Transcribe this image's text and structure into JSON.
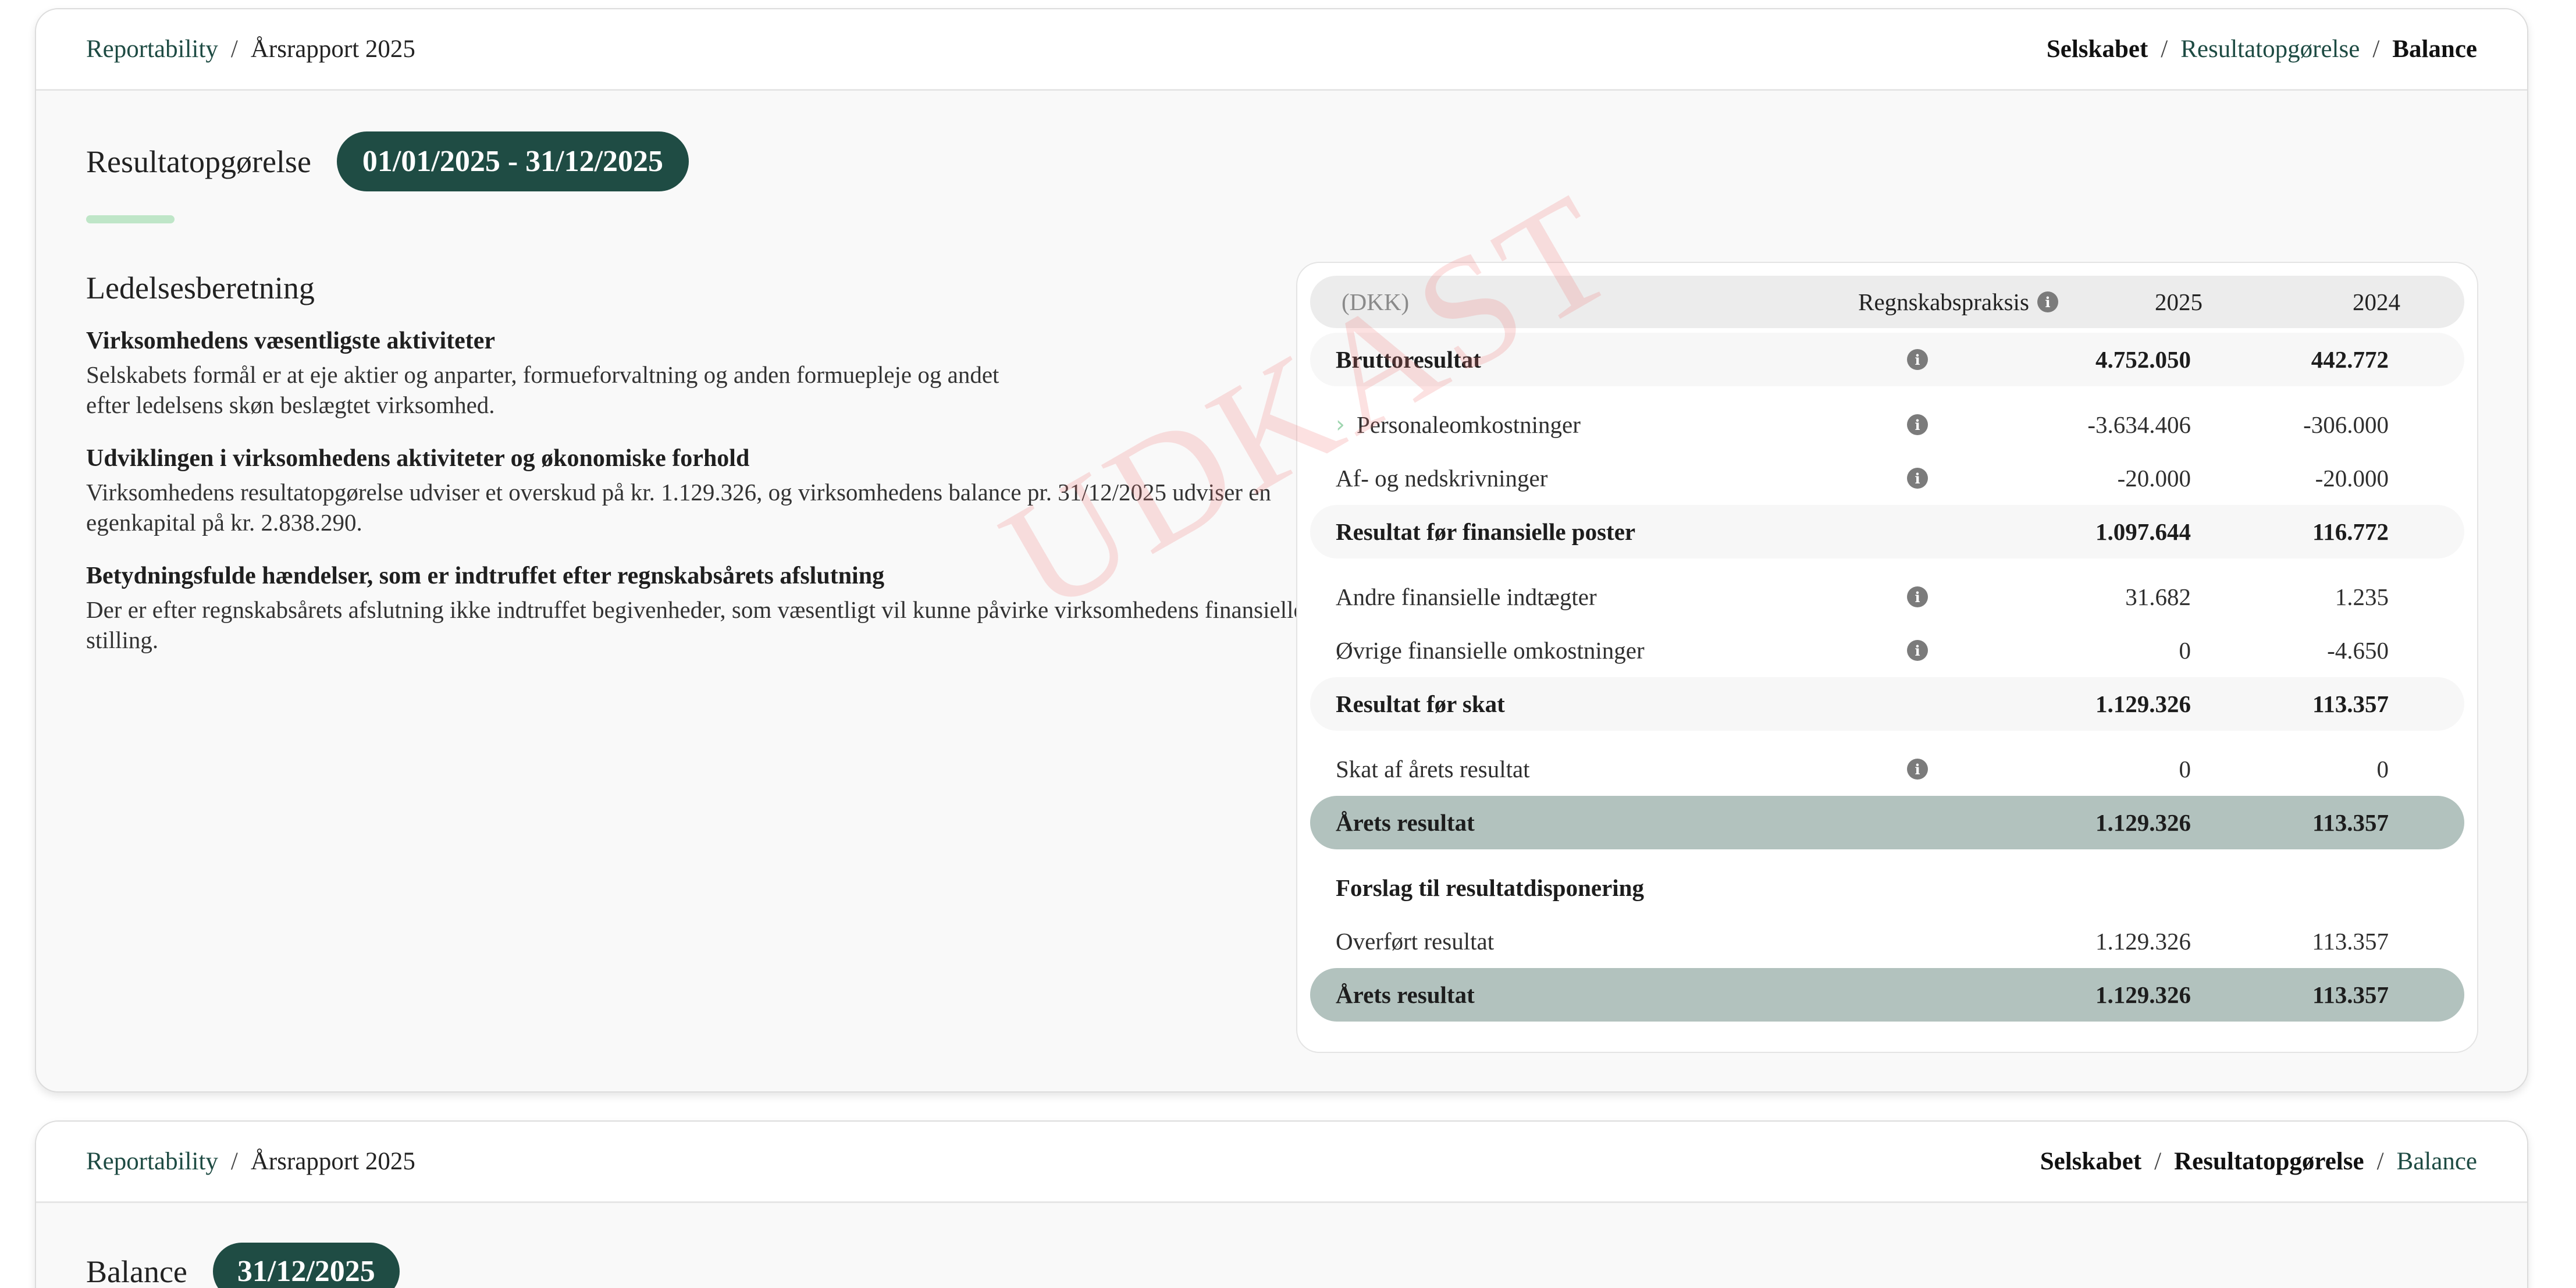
{
  "breadcrumb": {
    "root": "Reportability",
    "sep": "/",
    "current": "Årsrapport 2025"
  },
  "nav": {
    "company": "Selskabet",
    "sep": "/",
    "income": "Resultatopgørelse",
    "balance": "Balance"
  },
  "income": {
    "title": "Resultatopgørelse",
    "period": "01/01/2025 - 31/12/2025",
    "watermark": "UDKAST"
  },
  "management": {
    "title": "Ledelsesberetning",
    "sections": [
      {
        "heading": "Virksomhedens væsentligste aktiviteter",
        "body": "Selskabets formål er at eje aktier og anparter, formueforvaltning og anden formuepleje og andet efter ledelsens skøn beslægtet virksomhed."
      },
      {
        "heading": "Udviklingen i virksomhedens aktiviteter og økonomiske forhold",
        "body": "Virksomhedens resultatopgørelse udviser et overskud på kr. 1.129.326, og virksomhedens balance pr. 31/12/2025 udviser en egenkapital på kr. 2.838.290."
      },
      {
        "heading": "Betydningsfulde hændelser, som er indtruffet efter regnskabsårets afslutning",
        "body": "Der er efter regnskabsårets afslutning ikke indtruffet begivenheder, som væsentligt vil kunne påvirke virksomhedens finansielle stilling."
      }
    ]
  },
  "table": {
    "header": {
      "currency": "(DKK)",
      "practice": "Regnskabspraksis",
      "y1": "2025",
      "y2": "2024"
    },
    "rows": [
      {
        "label": "Bruttoresultat",
        "v1": "4.752.050",
        "v2": "442.772"
      },
      {
        "label": "Personaleomkostninger",
        "v1": "-3.634.406",
        "v2": "-306.000"
      },
      {
        "label": "Af- og nedskrivninger",
        "v1": "-20.000",
        "v2": "-20.000"
      },
      {
        "label": "Resultat før finansielle poster",
        "v1": "1.097.644",
        "v2": "116.772"
      },
      {
        "label": "Andre finansielle indtægter",
        "v1": "31.682",
        "v2": "1.235"
      },
      {
        "label": "Øvrige finansielle omkostninger",
        "v1": "0",
        "v2": "-4.650"
      },
      {
        "label": "Resultat før skat",
        "v1": "1.129.326",
        "v2": "113.357"
      },
      {
        "label": "Skat af årets resultat",
        "v1": "0",
        "v2": "0"
      },
      {
        "label": "Årets resultat",
        "v1": "1.129.326",
        "v2": "113.357"
      },
      {
        "label": "Forslag til resultatdisponering",
        "v1": "",
        "v2": ""
      },
      {
        "label": "Overført resultat",
        "v1": "1.129.326",
        "v2": "113.357"
      },
      {
        "label": "Årets resultat",
        "v1": "1.129.326",
        "v2": "113.357"
      }
    ]
  },
  "balance": {
    "title": "Balance",
    "date": "31/12/2025"
  },
  "icons": {
    "info": "info-icon",
    "chevron": "chevron-right-icon"
  },
  "colors": {
    "brand": "#1f4c44",
    "accent": "#bfe6c8",
    "total_row": "#b2c2be"
  }
}
